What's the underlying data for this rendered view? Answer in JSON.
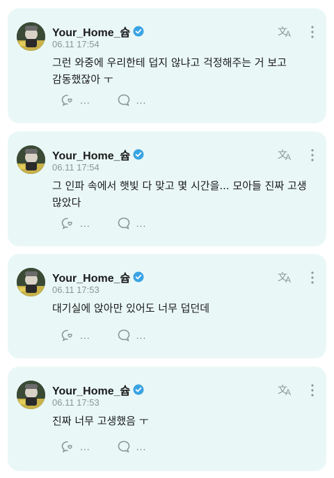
{
  "posts": [
    {
      "username": "Your_Home_슙",
      "timestamp": "06.11 17:54",
      "content": "그런 와중에 우리한테 덥지 않냐고 걱정해주는 거 보고 감동했잖아 ㅜ",
      "reaction_count": "...",
      "reply_count": "..."
    },
    {
      "username": "Your_Home_슙",
      "timestamp": "06.11 17:54",
      "content": "그 인파 속에서 햇빛 다 맞고 몇 시간을... 모아들 진짜 고생 많았다",
      "reaction_count": "...",
      "reply_count": "..."
    },
    {
      "username": "Your_Home_슙",
      "timestamp": "06.11 17:53",
      "content": "대기실에 앉아만 있어도 너무 덥던데",
      "reaction_count": "...",
      "reply_count": "..."
    },
    {
      "username": "Your_Home_슙",
      "timestamp": "06.11 17:53",
      "content": "진짜 너무 고생했음 ㅜ",
      "reaction_count": "...",
      "reply_count": "..."
    }
  ],
  "colors": {
    "card_background": "#e9f8f7",
    "verified_badge": "#3aa3e3",
    "icon_gray": "#8a9593"
  },
  "icons": {
    "verified": "verified-badge-icon",
    "translate": "translate-icon",
    "more": "more-vertical-icon",
    "reaction": "bubble-heart-icon",
    "reply": "comment-icon"
  }
}
